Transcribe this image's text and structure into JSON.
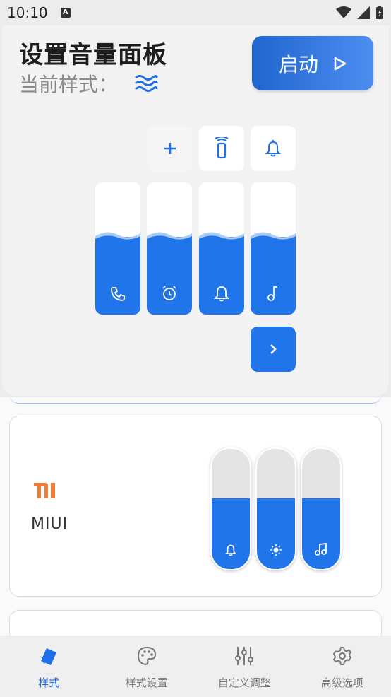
{
  "status_bar": {
    "time": "10:10",
    "notification_icon": "a-box-icon"
  },
  "header": {
    "title": "设置音量面板",
    "current_style_label": "当前样式：",
    "start_button": "启动"
  },
  "panel": {
    "top_buttons": [
      "add-icon",
      "phone-vibrate-icon",
      "bell-icon"
    ],
    "sliders": [
      {
        "icon": "phone-icon",
        "level": 0.6
      },
      {
        "icon": "alarm-icon",
        "level": 0.6
      },
      {
        "icon": "bell-icon",
        "level": 0.6
      },
      {
        "icon": "music-note-icon",
        "level": 0.6
      }
    ],
    "next_icon": "chevron-right-icon"
  },
  "styles": [
    {
      "name": "MIUI",
      "logo": "mi-logo",
      "sliders": [
        {
          "icon": "bell-icon",
          "level": 0.6
        },
        {
          "icon": "brightness-icon",
          "level": 0.6
        },
        {
          "icon": "music-icon",
          "level": 0.6
        }
      ]
    }
  ],
  "bottom_nav": [
    {
      "label": "样式",
      "icon": "style-card-icon",
      "active": true
    },
    {
      "label": "样式设置",
      "icon": "palette-icon",
      "active": false
    },
    {
      "label": "自定义调整",
      "icon": "equalizer-icon",
      "active": false
    },
    {
      "label": "高级选项",
      "icon": "gear-icon",
      "active": false
    }
  ],
  "colors": {
    "accent": "#2175ea",
    "mi_orange": "#f07c36"
  }
}
